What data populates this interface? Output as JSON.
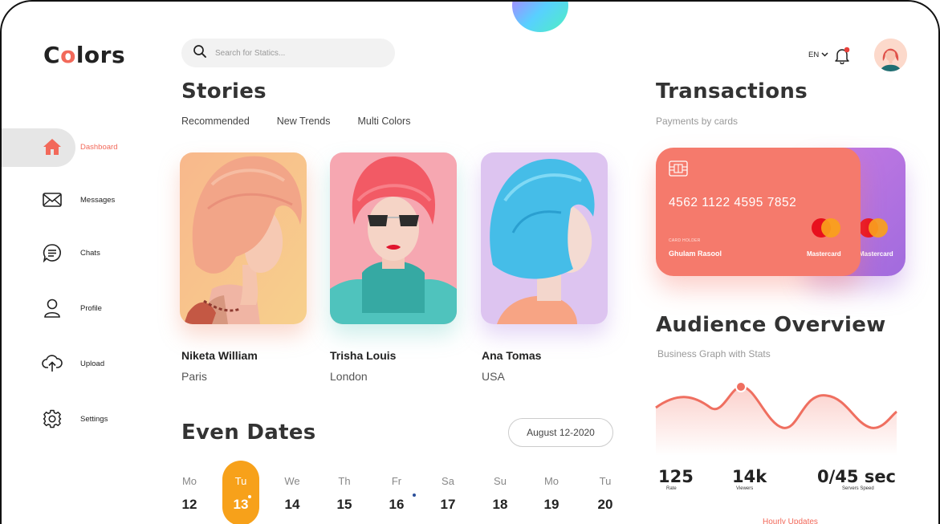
{
  "app": {
    "logo_prefix": "C",
    "logo_accent": "o",
    "logo_suffix": "lors",
    "accent_color": "#f2695a"
  },
  "sidebar": {
    "items": [
      {
        "label": "Dashboard",
        "icon": "home-icon",
        "active": true
      },
      {
        "label": "Messages",
        "icon": "envelope-icon"
      },
      {
        "label": "Chats",
        "icon": "chat-bubble-icon"
      },
      {
        "label": "Profile",
        "icon": "user-icon"
      },
      {
        "label": "Upload",
        "icon": "cloud-upload-icon"
      },
      {
        "label": "Settings",
        "icon": "gear-icon"
      }
    ]
  },
  "search": {
    "placeholder": "Search for Statics..."
  },
  "header": {
    "language": "EN",
    "notifications_icon": "bell-icon"
  },
  "stories": {
    "title": "Stories",
    "tabs": [
      "Recommended",
      "New Trends",
      "Multi Colors"
    ],
    "people": [
      {
        "name": "Niketa William",
        "city": "Paris"
      },
      {
        "name": "Trisha Louis",
        "city": "London"
      },
      {
        "name": "Ana Tomas",
        "city": "USA"
      }
    ]
  },
  "even_dates": {
    "title": "Even Dates",
    "range": "August 12-2020",
    "days": [
      {
        "name": "Mo",
        "date": "12"
      },
      {
        "name": "Tu",
        "date": "13",
        "active": true
      },
      {
        "name": "We",
        "date": "14"
      },
      {
        "name": "Th",
        "date": "15"
      },
      {
        "name": "Fr",
        "date": "16"
      },
      {
        "name": "Sa",
        "date": "17"
      },
      {
        "name": "Su",
        "date": "18"
      },
      {
        "name": "Mo",
        "date": "19"
      },
      {
        "name": "Tu",
        "date": "20"
      }
    ]
  },
  "transactions": {
    "title": "Transactions",
    "subtitle": "Payments by cards",
    "card": {
      "number": "4562 1122 4595 7852",
      "holder_label": "CARD HOLDER",
      "holder": "Ghulam Rasool",
      "brand": "Mastercard",
      "color": "#f57a6c"
    },
    "back_card": {
      "brand": "Mastercard",
      "color": "#b070e0"
    }
  },
  "audience": {
    "title": "Audience Overview",
    "subtitle": "Business Graph with Stats",
    "stats": [
      {
        "value": "125",
        "label": "Rate"
      },
      {
        "value": "14k",
        "label": "Viewers"
      },
      {
        "value": "0/45 sec",
        "label": "Servers Speed"
      }
    ],
    "link": "Hourly Updates"
  }
}
